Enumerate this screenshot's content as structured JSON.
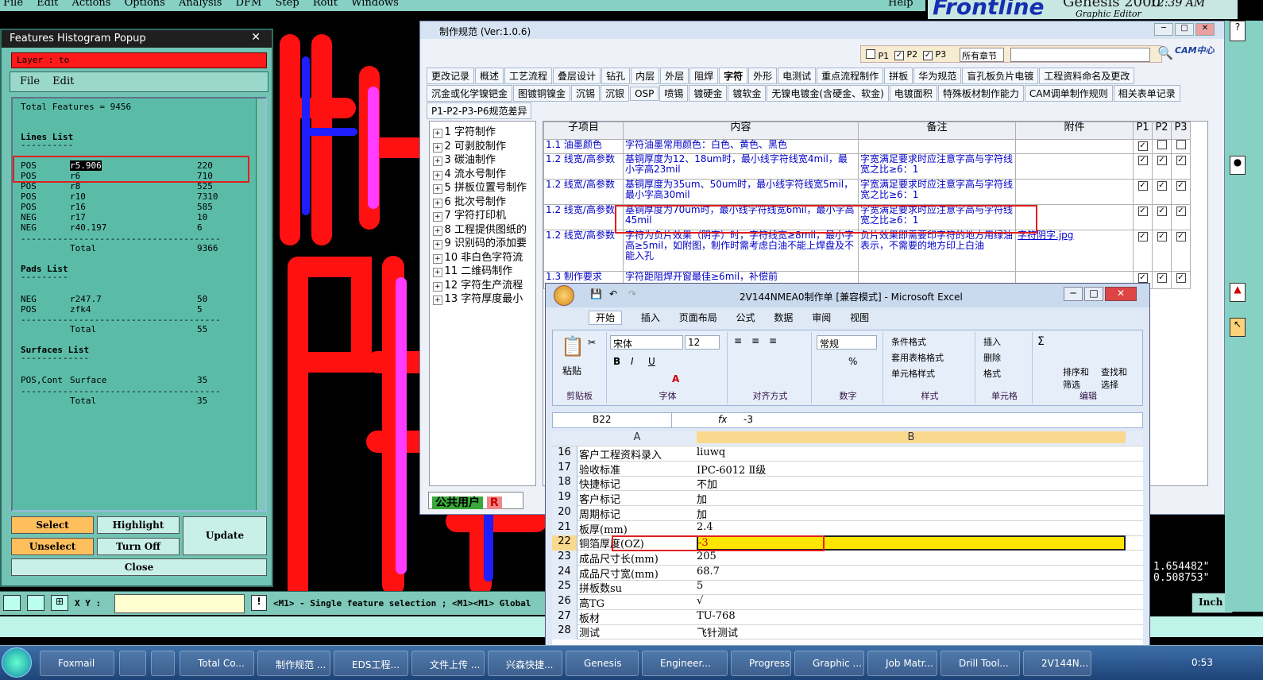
{
  "menubar": [
    "File",
    "Edit",
    "Actions",
    "Options",
    "Analysis",
    "DFM",
    "Step",
    "Rout",
    "Windows"
  ],
  "help": "Help",
  "logo": {
    "brand": "Frontline",
    "product": "Genesis 2000",
    "subtitle": "Graphic Editor",
    "time": "12:39 AM"
  },
  "histogram": {
    "title": "Features Histogram Popup",
    "layer_text": "Layer :  to",
    "menu": [
      "File",
      "Edit"
    ],
    "total_features": "Total Features = 9456",
    "lines_header": "Lines List",
    "lines": [
      {
        "pol": "POS",
        "sym": "r5.906",
        "count": "220"
      },
      {
        "pol": "POS",
        "sym": "r6",
        "count": "710"
      },
      {
        "pol": "POS",
        "sym": "r8",
        "count": "525"
      },
      {
        "pol": "POS",
        "sym": "r10",
        "count": "7310"
      },
      {
        "pol": "POS",
        "sym": "r16",
        "count": "585"
      },
      {
        "pol": "NEG",
        "sym": "r17",
        "count": "10"
      },
      {
        "pol": "NEG",
        "sym": "r40.197",
        "count": "6"
      }
    ],
    "lines_total_label": "Total",
    "lines_total": "9366",
    "pads_header": "Pads List",
    "pads": [
      {
        "pol": "NEG",
        "sym": "r247.7",
        "count": "50"
      },
      {
        "pol": "POS",
        "sym": "zfk4",
        "count": "5"
      }
    ],
    "pads_total": "55",
    "surfaces_header": "Surfaces List",
    "surfaces": [
      {
        "pol": "POS,Cont",
        "sym": "Surface",
        "count": "35"
      }
    ],
    "surfaces_total": "35",
    "buttons": {
      "select": "Select",
      "highlight": "Highlight",
      "unselect": "Unselect",
      "turnoff": "Turn Off",
      "update": "Update",
      "close": "Close"
    }
  },
  "statusbar": {
    "xy_label": "X Y :",
    "message": "<M1> - Single feature selection ; <M1><M1> Global",
    "coord1": "1.654482\"",
    "coord2": "0.508753\"",
    "units": "Inch"
  },
  "spec": {
    "title": "制作规范 (Ver:1.0.6)",
    "filters": [
      "P1",
      "P2",
      "P3"
    ],
    "chapter_select": "所有章节",
    "search_logo": "CAM中心",
    "tabs_row1": [
      "更改记录",
      "概述",
      "工艺流程",
      "叠层设计",
      "钻孔",
      "内层",
      "外层",
      "阻焊",
      "字符",
      "外形",
      "电测试",
      "重点流程制作",
      "拼板",
      "华为规范",
      "盲孔板负片电镀",
      "工程资料命名及更改"
    ],
    "tabs_row2": [
      "沉金或化学镍钯金",
      "图镀铜镍金",
      "沉锡",
      "沉银",
      "OSP",
      "喷锡",
      "镀硬金",
      "镀软金",
      "无镍电镀金(含硬金、软金)",
      "电镀面积",
      "特殊板材制作能力",
      "CAM调单制作规则",
      "相关表单记录"
    ],
    "tabs_row3": [
      "P1-P2-P3-P6规范差异"
    ],
    "tree": [
      "1 字符制作",
      "2 可剥胶制作",
      "3 碳油制作",
      "4 流水号制作",
      "5 拼板位置号制作",
      "6 批次号制作",
      "7 字符打印机",
      "8 工程提供图纸的",
      "9 识别码的添加要",
      "10 非白色字符流",
      "11 二维码制作",
      "12 字符生产流程",
      "13 字符厚度最小"
    ],
    "columns": [
      "子项目",
      "内容",
      "备注",
      "附件",
      "P1",
      "P2",
      "P3"
    ],
    "rows": [
      {
        "item": "1.1 油墨颜色",
        "content": "字符油墨常用颜色：白色、黄色、黑色",
        "note": "",
        "att": ""
      },
      {
        "item": "1.2 线宽/高参数",
        "content": "基铜厚度为12、18um时，最小线字符线宽4mil，最小字高23mil",
        "note": "字宽满足要求时应注意字高与字符线宽之比≥6：1",
        "att": ""
      },
      {
        "item": "1.2 线宽/高参数",
        "content": "基铜厚度为35um、50um时，最小线字符线宽5mil，最小字高30mil",
        "note": "字宽满足要求时应注意字高与字符线宽之比≥6：1",
        "att": ""
      },
      {
        "item": "1.2 线宽/高参数",
        "content": "基铜厚度为70um时，最小线字符线宽6mil，最小字高45mil",
        "note": "字宽满足要求时应注意字高与字符线宽之比≥6：1",
        "att": ""
      },
      {
        "item": "1.2 线宽/高参数",
        "content": "字符为负片效果（阴字）时，字符线宽≥8mil，最小字高≥5mil，如附图，制作时需考虑白油不能上焊盘及不能入孔",
        "note": "负片效果即需要印字符的地方用绿油表示，不需要的地方印上白油",
        "att": "字符阴字.jpg"
      },
      {
        "item": "1.3 制作要求",
        "content": "字符距阻焊开窗最佳≥6mil，补偿前",
        "note": "",
        "att": ""
      }
    ],
    "footer_user": "公共用户",
    "footer_r": "R"
  },
  "excel": {
    "title": "2V144NMEA0制作单 [兼容模式] - Microsoft Excel",
    "tabs": [
      "开始",
      "插入",
      "页面布局",
      "公式",
      "数据",
      "审阅",
      "视图"
    ],
    "font": "宋体",
    "size": "12",
    "numfmt": "常规",
    "groups": [
      "剪贴板",
      "字体",
      "对齐方式",
      "数字",
      "样式",
      "单元格",
      "编辑"
    ],
    "paste": "粘贴",
    "style_items": [
      "条件格式",
      "套用表格格式",
      "单元格样式"
    ],
    "cell_items": [
      "插入",
      "删除",
      "格式"
    ],
    "edit_items": [
      "排序和筛选",
      "查找和选择"
    ],
    "namebox": "B22",
    "formula": "-3",
    "col_a": "A",
    "col_b": "B",
    "rows": [
      {
        "n": "16",
        "a": "客户工程资料录入",
        "b": "liuwq"
      },
      {
        "n": "17",
        "a": "验收标准",
        "b": "IPC-6012 Ⅱ级"
      },
      {
        "n": "18",
        "a": "快捷标记",
        "b": "不加"
      },
      {
        "n": "19",
        "a": "客户标记",
        "b": "加"
      },
      {
        "n": "20",
        "a": "周期标记",
        "b": "加"
      },
      {
        "n": "21",
        "a": "板厚(mm)",
        "b": "2.4"
      },
      {
        "n": "22",
        "a": "铜箔厚度(OZ)",
        "b": "-3"
      },
      {
        "n": "23",
        "a": "成品尺寸长(mm)",
        "b": "205"
      },
      {
        "n": "24",
        "a": "成品尺寸宽(mm)",
        "b": "68.7"
      },
      {
        "n": "25",
        "a": "拼板数su",
        "b": "5"
      },
      {
        "n": "26",
        "a": "高TG",
        "b": "√"
      },
      {
        "n": "27",
        "a": "板材",
        "b": "TU-768"
      },
      {
        "n": "28",
        "a": "测试",
        "b": "飞针测试"
      }
    ]
  },
  "taskbar": {
    "items": [
      "Foxmail",
      "",
      "",
      "Total Co...",
      "制作规范 ...",
      "EDS工程...",
      "文件上传 ...",
      "兴森快捷...",
      "Genesis",
      "Engineer...",
      "Progress",
      "Graphic ...",
      "Job Matr...",
      "Drill Tool...",
      "2V144N..."
    ],
    "time": "0:53"
  },
  "colors": {
    "genesis_bg": "#71c3b4",
    "highlight_red": "#e02020",
    "excel_selected": "#ffe600"
  }
}
